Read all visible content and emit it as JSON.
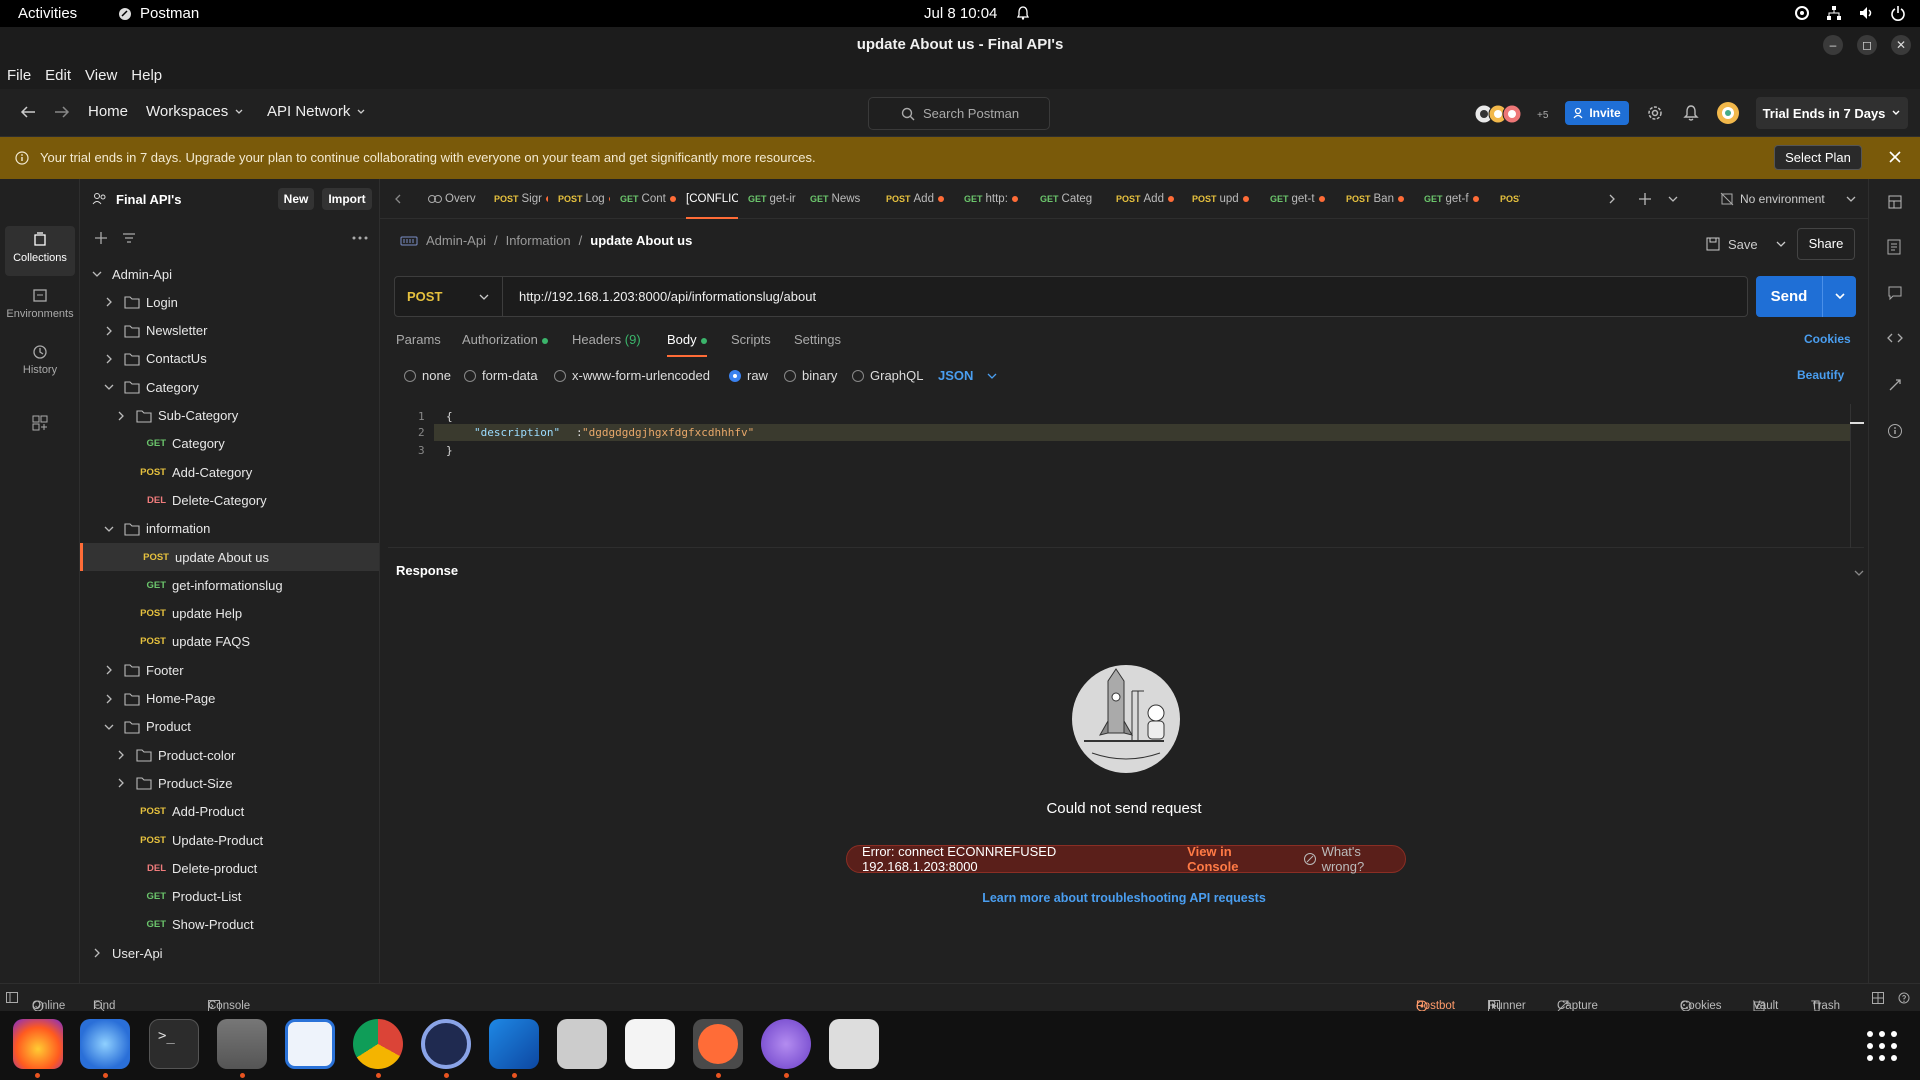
{
  "system": {
    "activities": "Activities",
    "app_name": "Postman",
    "clock": "Jul 8  10:04"
  },
  "window": {
    "title": "update About us - Final API's"
  },
  "menu": [
    "File",
    "Edit",
    "View",
    "Help"
  ],
  "nav": {
    "home": "Home",
    "workspaces": "Workspaces",
    "api_network": "API Network",
    "search_placeholder": "Search Postman",
    "avatar_count": "+5",
    "invite": "Invite",
    "trial": "Trial Ends in 7 Days"
  },
  "banner": {
    "text": "Your trial ends in 7 days. Upgrade your plan to continue collaborating with everyone on your team and get significantly more resources.",
    "select_plan": "Select Plan"
  },
  "rail": {
    "collections": "Collections",
    "environments": "Environments",
    "history": "History"
  },
  "sidebar": {
    "workspace": "Final API's",
    "new_btn": "New",
    "import_btn": "Import",
    "tree": [
      {
        "label": "Admin-Api",
        "type": "collection",
        "level": 0,
        "expanded": true
      },
      {
        "label": "Login",
        "type": "folder",
        "level": 1
      },
      {
        "label": "Newsletter",
        "type": "folder",
        "level": 1
      },
      {
        "label": "ContactUs",
        "type": "folder",
        "level": 1
      },
      {
        "label": "Category",
        "type": "folder",
        "level": 1,
        "expanded": true
      },
      {
        "label": "Sub-Category",
        "type": "folder",
        "level": 2
      },
      {
        "label": "Category",
        "type": "request",
        "method": "GET",
        "level": 2
      },
      {
        "label": "Add-Category",
        "type": "request",
        "method": "POST",
        "level": 2
      },
      {
        "label": "Delete-Category",
        "type": "request",
        "method": "DEL",
        "level": 2
      },
      {
        "label": "information",
        "type": "folder",
        "level": 1,
        "expanded": true
      },
      {
        "label": "update About us",
        "type": "request",
        "method": "POST",
        "level": 2,
        "selected": true
      },
      {
        "label": "get-informationslug",
        "type": "request",
        "method": "GET",
        "level": 2
      },
      {
        "label": "update Help",
        "type": "request",
        "method": "POST",
        "level": 2
      },
      {
        "label": "update FAQS",
        "type": "request",
        "method": "POST",
        "level": 2
      },
      {
        "label": "Footer",
        "type": "folder",
        "level": 1
      },
      {
        "label": "Home-Page",
        "type": "folder",
        "level": 1
      },
      {
        "label": "Product",
        "type": "folder",
        "level": 1,
        "expanded": true
      },
      {
        "label": "Product-color",
        "type": "folder",
        "level": 2
      },
      {
        "label": "Product-Size",
        "type": "folder",
        "level": 2
      },
      {
        "label": "Add-Product",
        "type": "request",
        "method": "POST",
        "level": 2
      },
      {
        "label": "Update-Product",
        "type": "request",
        "method": "POST",
        "level": 2
      },
      {
        "label": "Delete-product",
        "type": "request",
        "method": "DEL",
        "level": 2
      },
      {
        "label": "Product-List",
        "type": "request",
        "method": "GET",
        "level": 2
      },
      {
        "label": "Show-Product",
        "type": "request",
        "method": "GET",
        "level": 2
      },
      {
        "label": "User-Api",
        "type": "collection",
        "level": 0
      }
    ]
  },
  "tabs": [
    {
      "method": "",
      "label": "Overv",
      "dot": false
    },
    {
      "method": "POST",
      "label": "Sigr",
      "dot": true
    },
    {
      "method": "POST",
      "label": "Log",
      "dot": true
    },
    {
      "method": "GET",
      "label": "Cont",
      "dot": true
    },
    {
      "method": "",
      "label": "[CONFLIC",
      "dot": true,
      "active": true
    },
    {
      "method": "GET",
      "label": "get-ir",
      "dot": false
    },
    {
      "method": "GET",
      "label": "News",
      "dot": false
    },
    {
      "method": "POST",
      "label": "Add",
      "dot": true
    },
    {
      "method": "GET",
      "label": "http:",
      "dot": true
    },
    {
      "method": "GET",
      "label": "Categ",
      "dot": false
    },
    {
      "method": "POST",
      "label": "Add",
      "dot": true
    },
    {
      "method": "POST",
      "label": "upd",
      "dot": true
    },
    {
      "method": "GET",
      "label": "get-t",
      "dot": true
    },
    {
      "method": "POST",
      "label": "Ban",
      "dot": true
    },
    {
      "method": "GET",
      "label": "get-f",
      "dot": true
    },
    {
      "method": "POST",
      "label": "",
      "dot": false
    }
  ],
  "environment": "No environment",
  "breadcrumb": [
    "Admin-Api",
    "Information",
    "update About us"
  ],
  "actions": {
    "save": "Save",
    "share": "Share"
  },
  "request": {
    "method": "POST",
    "url": "http://192.168.1.203:8000/api/informationslug/about",
    "send": "Send"
  },
  "request_tabs": {
    "params": "Params",
    "authorization": "Authorization",
    "headers": "Headers",
    "headers_count": "(9)",
    "body": "Body",
    "scripts": "Scripts",
    "settings": "Settings",
    "cookies": "Cookies"
  },
  "body_options": {
    "none": "none",
    "form_data": "form-data",
    "urlencoded": "x-www-form-urlencoded",
    "raw": "raw",
    "binary": "binary",
    "graphql": "GraphQL",
    "format": "JSON",
    "beautify": "Beautify",
    "selected": "raw"
  },
  "editor": {
    "lines": [
      "1",
      "2",
      "3"
    ],
    "open": "{",
    "key": "\"description\"",
    "colon": ":",
    "value": "\"dgdgdgdgjhgxfdgfxcdhhhfv\"",
    "close": "}"
  },
  "response": {
    "title": "Response",
    "message": "Could not send request",
    "error": "Error: connect ECONNREFUSED 192.168.1.203:8000",
    "view_console": "View in Console",
    "whats_wrong": "What's wrong?",
    "learn_more": "Learn more about troubleshooting API requests"
  },
  "statusbar": {
    "online": "Online",
    "find_replace": "Find and replace",
    "console": "Console",
    "postbot": "Postbot",
    "runner": "Runner",
    "capture": "Capture requests",
    "cookies": "Cookies",
    "vault": "Vault",
    "trash": "Trash"
  },
  "colors": {
    "accent": "#ff6c37",
    "send": "#1f6fd6",
    "post": "#e6c13e",
    "get": "#6bc56c",
    "del": "#f07c7c",
    "banner": "#7a5a0a"
  }
}
